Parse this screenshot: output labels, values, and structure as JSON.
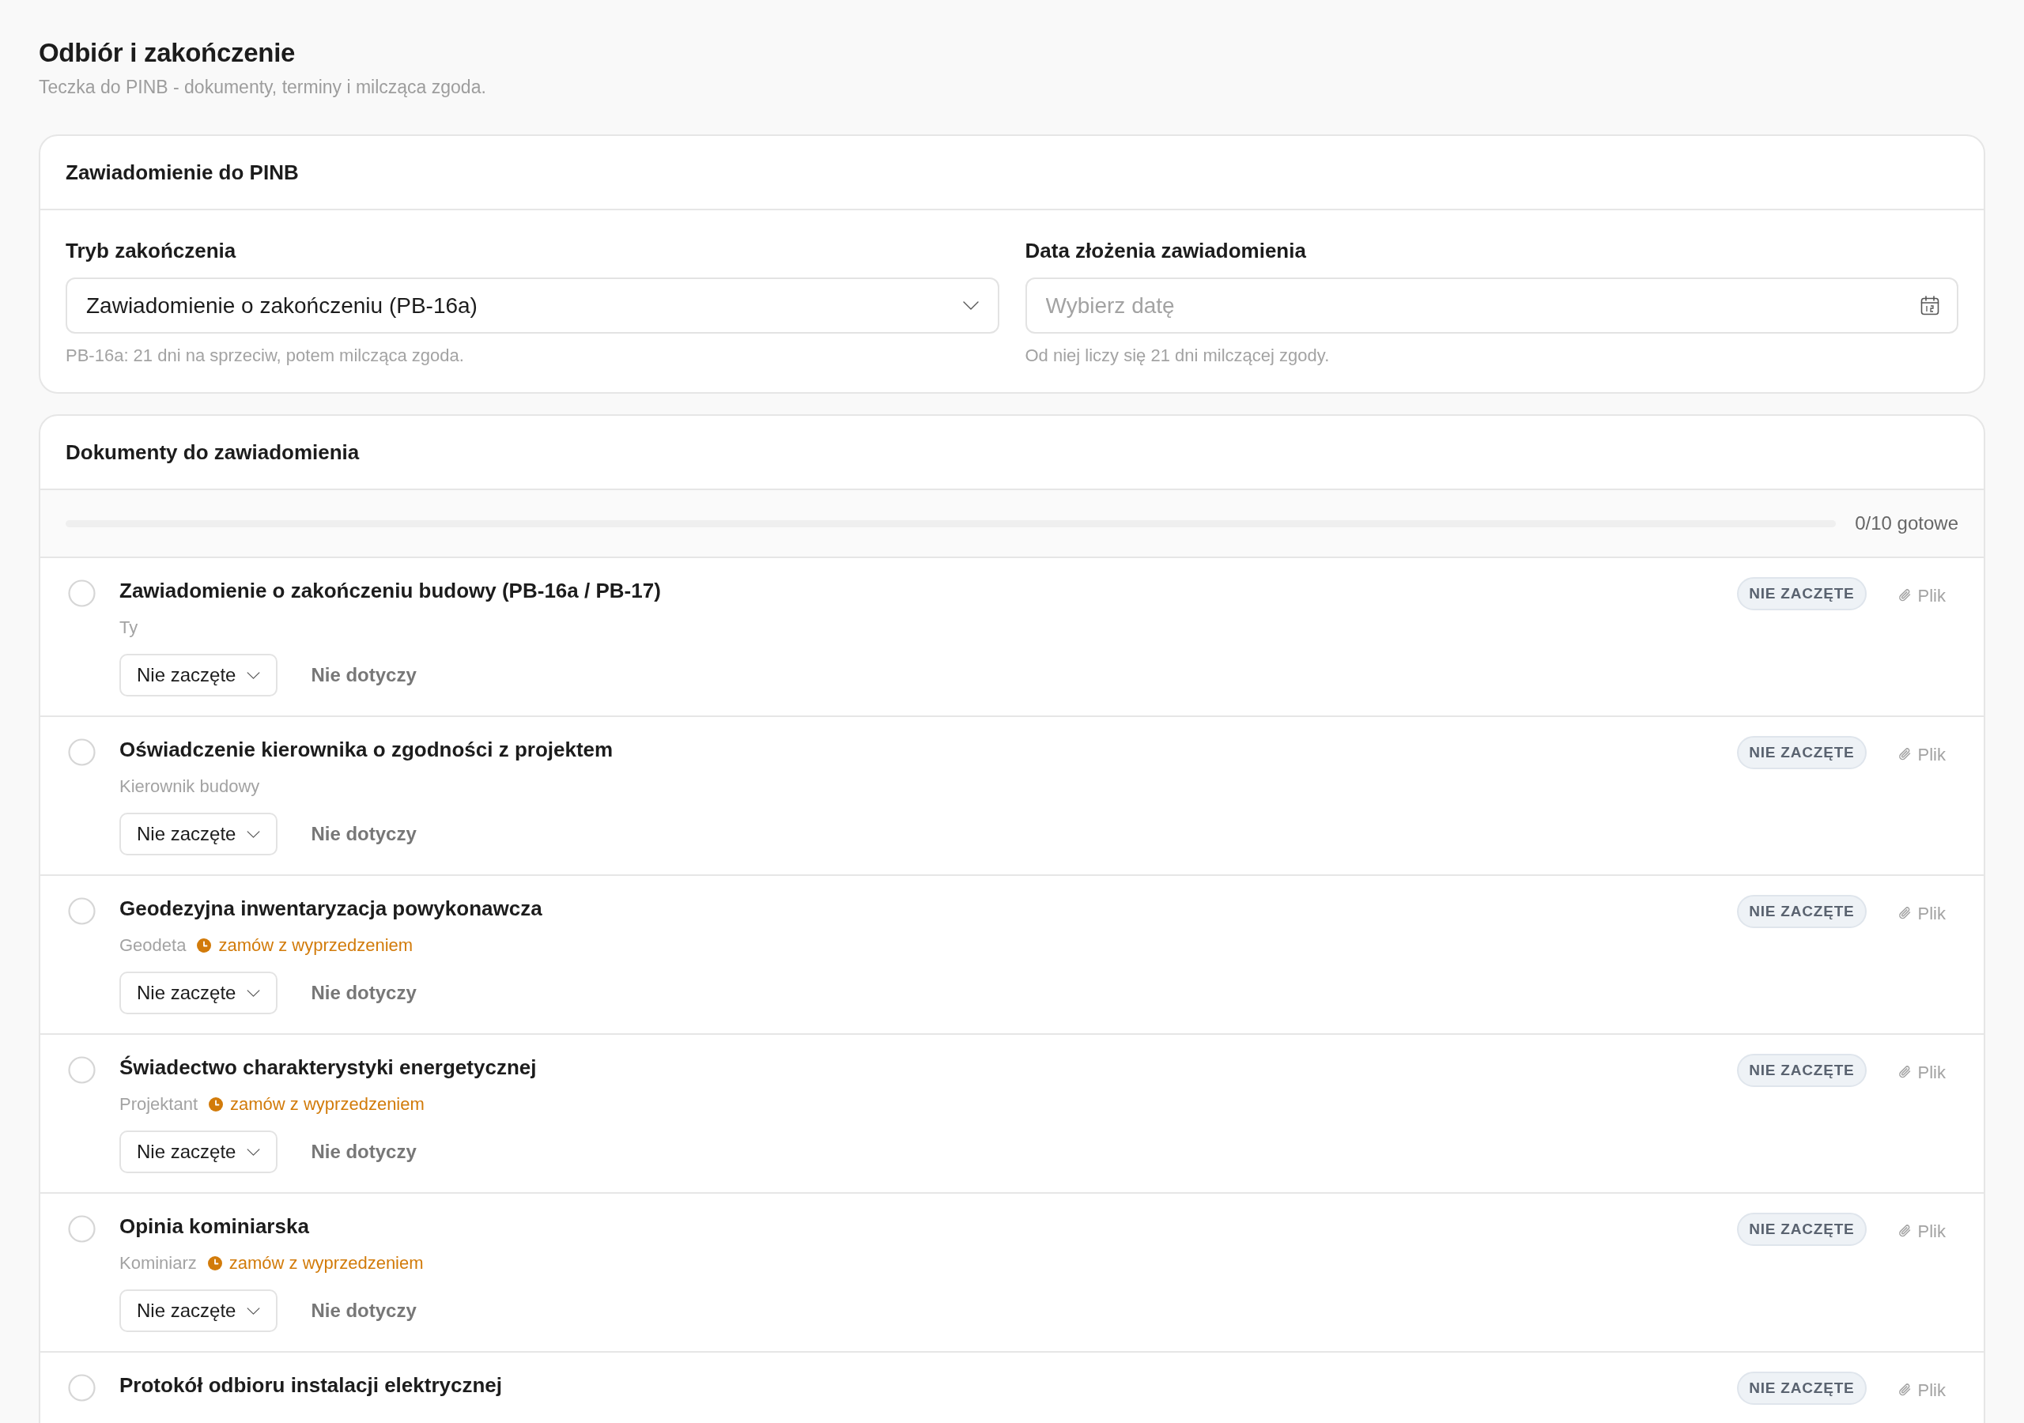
{
  "page": {
    "title": "Odbiór i zakończenie",
    "subtitle": "Teczka do PINB - dokumenty, terminy i milcząca zgoda."
  },
  "notice_card": {
    "title": "Zawiadomienie do PINB",
    "fields": [
      {
        "kind": "select",
        "label": "Tryb zakończenia",
        "value": "Zawiadomienie o zakończeniu (PB-16a)",
        "help": "PB-16a: 21 dni na sprzeciw, potem milcząca zgoda."
      },
      {
        "kind": "date",
        "label": "Data złożenia zawiadomienia",
        "placeholder": "Wybierz datę",
        "help": "Od niej liczy się 21 dni milczącej zgody."
      }
    ]
  },
  "documents_card": {
    "title": "Dokumenty do zawiadomienia",
    "progress": {
      "level": 0,
      "reading": "0/10 gotowe"
    },
    "items": [
      {
        "title": "Zawiadomienie o zakończeniu budowy (PB-16a / PB-17)",
        "owner": "Ty",
        "checked": false,
        "status": "Nie zaczęte",
        "not_applicable": "Nie dotyczy",
        "badge": "NIE ZACZĘTE",
        "file": "Plik"
      },
      {
        "title": "Oświadczenie kierownika o zgodności z projektem",
        "owner": "Kierownik budowy",
        "checked": false,
        "status": "Nie zaczęte",
        "not_applicable": "Nie dotyczy",
        "badge": "NIE ZACZĘTE",
        "file": "Plik"
      },
      {
        "title": "Geodezyjna inwentaryzacja powykonawcza",
        "owner": "Geodeta",
        "note": "zamów z wyprzedzeniem",
        "checked": false,
        "status": "Nie zaczęte",
        "not_applicable": "Nie dotyczy",
        "badge": "NIE ZACZĘTE",
        "file": "Plik"
      },
      {
        "title": "Świadectwo charakterystyki energetycznej",
        "owner": "Projektant",
        "note": "zamów z wyprzedzeniem",
        "checked": false,
        "status": "Nie zaczęte",
        "not_applicable": "Nie dotyczy",
        "badge": "NIE ZACZĘTE",
        "file": "Plik"
      },
      {
        "title": "Opinia kominiarska",
        "owner": "Kominiarz",
        "note": "zamów z wyprzedzeniem",
        "checked": false,
        "status": "Nie zaczęte",
        "not_applicable": "Nie dotyczy",
        "badge": "NIE ZACZĘTE",
        "file": "Plik"
      },
      {
        "title": "Protokół odbioru instalacji elektrycznej",
        "checked": false,
        "badge": "NIE ZACZĘTE",
        "file": "Plik"
      }
    ]
  }
}
